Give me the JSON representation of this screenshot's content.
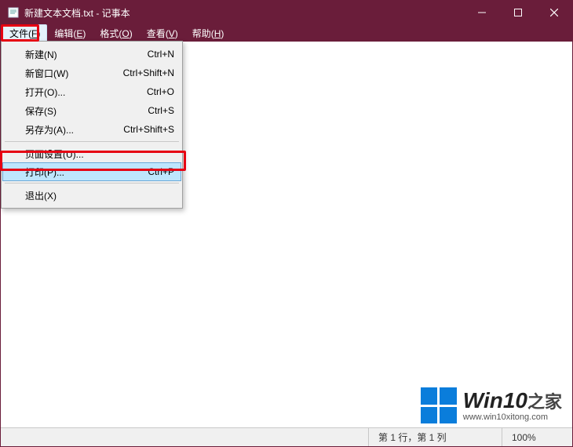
{
  "titlebar": {
    "title": "新建文本文档.txt - 记事本"
  },
  "menubar": {
    "items": [
      {
        "label": "文件",
        "key": "F",
        "active": true
      },
      {
        "label": "编辑",
        "key": "E",
        "active": false
      },
      {
        "label": "格式",
        "key": "O",
        "active": false
      },
      {
        "label": "查看",
        "key": "V",
        "active": false
      },
      {
        "label": "帮助",
        "key": "H",
        "active": false
      }
    ]
  },
  "fileMenu": {
    "items": [
      {
        "label": "新建(N)",
        "shortcut": "Ctrl+N",
        "type": "item"
      },
      {
        "label": "新窗口(W)",
        "shortcut": "Ctrl+Shift+N",
        "type": "item"
      },
      {
        "label": "打开(O)...",
        "shortcut": "Ctrl+O",
        "type": "item"
      },
      {
        "label": "保存(S)",
        "shortcut": "Ctrl+S",
        "type": "item"
      },
      {
        "label": "另存为(A)...",
        "shortcut": "Ctrl+Shift+S",
        "type": "item"
      },
      {
        "type": "sep"
      },
      {
        "label": "页面设置(U)...",
        "shortcut": "",
        "type": "item"
      },
      {
        "label": "打印(P)...",
        "shortcut": "Ctrl+P",
        "type": "item",
        "highlight": true
      },
      {
        "type": "sep"
      },
      {
        "label": "退出(X)",
        "shortcut": "",
        "type": "item"
      }
    ]
  },
  "statusbar": {
    "position": "第 1 行，第 1 列",
    "zoom": "100%"
  },
  "watermark": {
    "brand": "Win10",
    "suffix": "之家",
    "url": "www.win10xitong.com"
  }
}
